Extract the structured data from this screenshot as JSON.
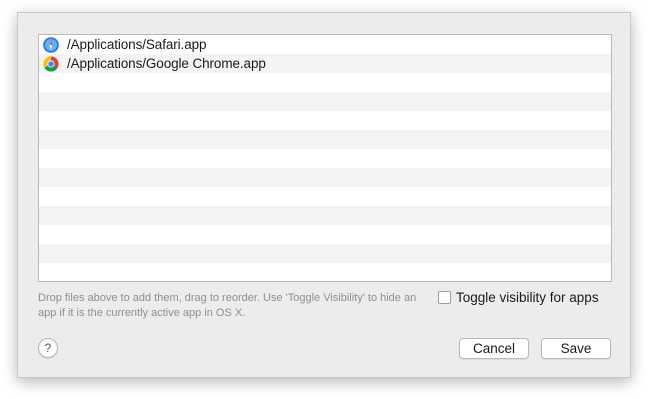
{
  "file_list": {
    "items": [
      {
        "path": "/Applications/Safari.app",
        "icon": "safari-icon"
      },
      {
        "path": "/Applications/Google Chrome.app",
        "icon": "chrome-icon"
      }
    ]
  },
  "hint": {
    "text": "Drop files above to add them, drag to reorder. Use 'Toggle Visibility' to hide an app if it is the currently active app in OS X."
  },
  "toggle": {
    "label": "Toggle visibility for apps",
    "checked": false
  },
  "help": {
    "label": "?"
  },
  "buttons": {
    "cancel_label": "Cancel",
    "save_label": "Save"
  },
  "colors": {
    "sheet_bg": "#ececec",
    "list_stripe": "#f3f3f3",
    "hint_text": "#8f8f8f"
  }
}
